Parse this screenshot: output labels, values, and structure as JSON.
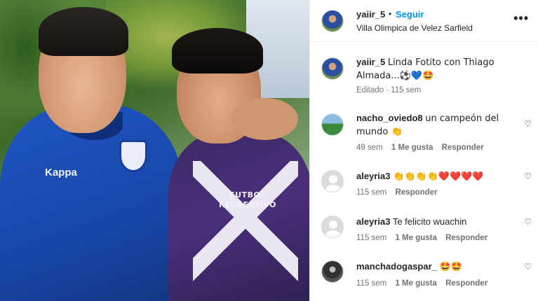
{
  "post": {
    "username": "yaiir_5",
    "separator": "•",
    "follow_label": "Seguir",
    "location": "Villa Olimpica de Velez Sarfield",
    "more_icon": "more-icon",
    "more_glyph": "•••"
  },
  "photo": {
    "jersey_text_line1": "FUTBOL",
    "jersey_text_line2": "RECREATIVO",
    "brand": "Kappa"
  },
  "comments": [
    {
      "username": "yaiir_5",
      "text": "Linda Fotito con Thiago Almada...⚽💙🤩",
      "time": "Editado · 115 sem",
      "likes": "",
      "reply": ""
    },
    {
      "username": "nacho_oviedo8",
      "text": "un campeón del mundo 👏",
      "time": "49 sem",
      "likes": "1 Me gusta",
      "reply": "Responder"
    },
    {
      "username": "aleyria3",
      "text": "👏👏👏👏❤️❤️❤️❤️",
      "time": "115 sem",
      "likes": "",
      "reply": "Responder"
    },
    {
      "username": "aleyria3",
      "text": "Te felicito wuachin",
      "time": "115 sem",
      "likes": "1 Me gusta",
      "reply": "Responder"
    },
    {
      "username": "manchadogaspar_",
      "text": "🤩🤩",
      "time": "115 sem",
      "likes": "1 Me gusta",
      "reply": "Responder"
    }
  ],
  "colors": {
    "follow": "#0095f6",
    "text": "#262626",
    "meta": "#737373"
  }
}
